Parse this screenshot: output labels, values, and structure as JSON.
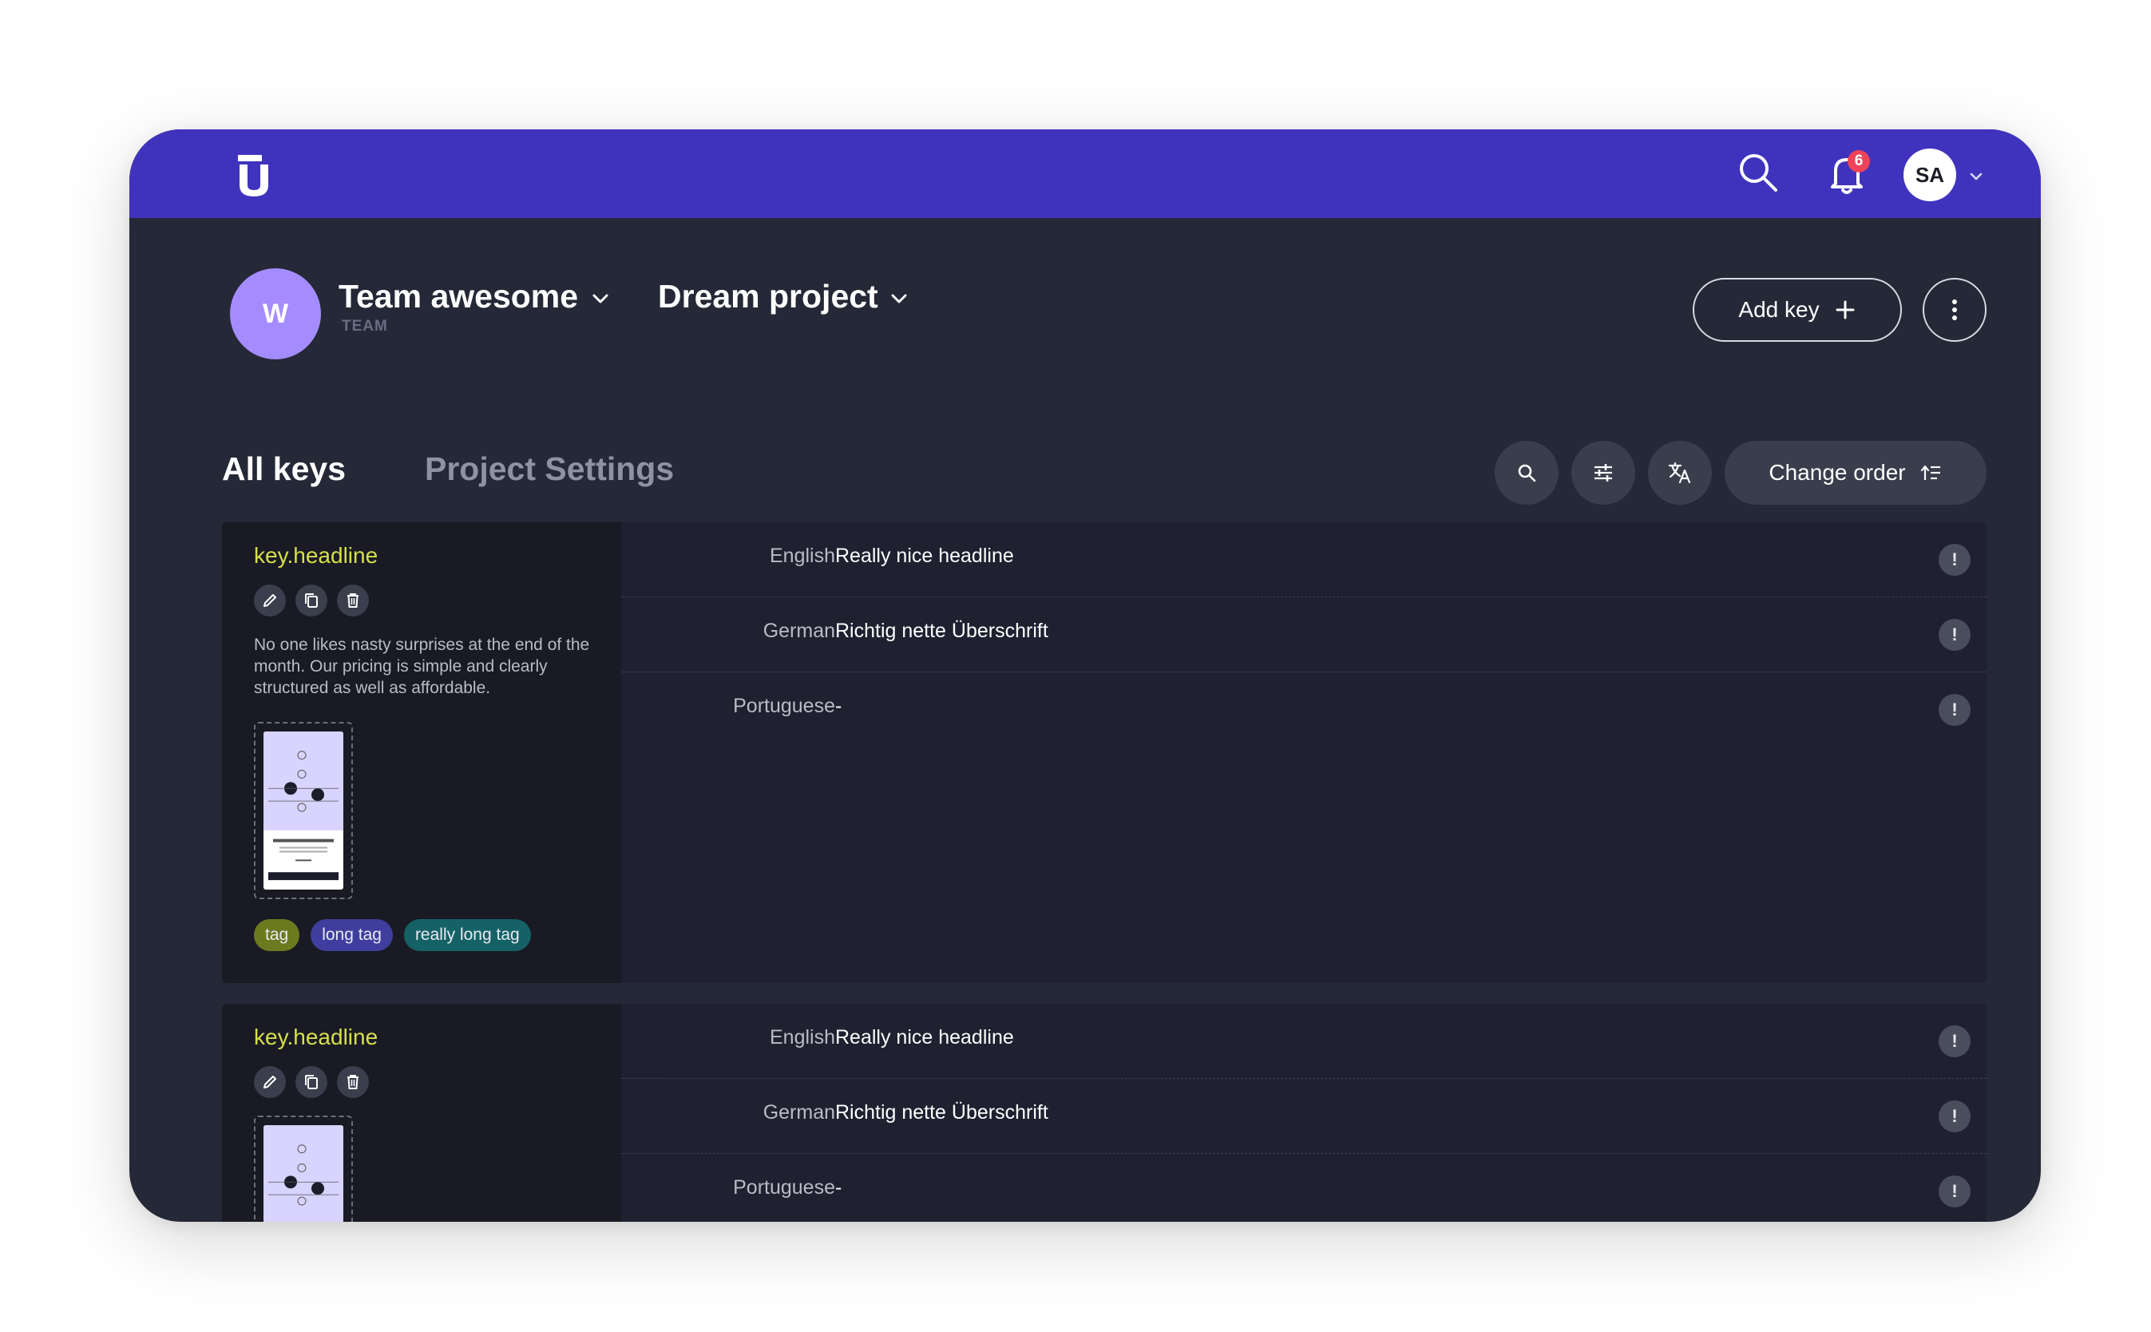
{
  "topbar": {
    "notification_count": "6",
    "user_initials": "SA"
  },
  "header": {
    "team_initial": "W",
    "team_name": "Team awesome",
    "team_label": "TEAM",
    "project_name": "Dream project",
    "add_key_label": "Add key"
  },
  "tabs": {
    "active": "All keys",
    "inactive": "Project Settings"
  },
  "toolbar": {
    "change_order_label": "Change order"
  },
  "keys": [
    {
      "name": "key.headline",
      "description": "No one likes nasty surprises at the end of the month. Our pricing is simple and clearly structured as well as affordable.",
      "tags": [
        "tag",
        "long tag",
        "really long tag"
      ],
      "translations": [
        {
          "language": "English",
          "value": "Really nice headline"
        },
        {
          "language": "German",
          "value": "Richtig nette Überschrift"
        },
        {
          "language": "Portuguese",
          "value": "-"
        }
      ]
    },
    {
      "name": "key.headline",
      "translations": [
        {
          "language": "English",
          "value": "Really nice headline"
        },
        {
          "language": "German",
          "value": "Richtig nette Überschrift"
        },
        {
          "language": "Portuguese",
          "value": "-"
        }
      ]
    }
  ],
  "colors": {
    "topbar": "#3F33BE",
    "background": "#252836",
    "key_name": "#D6E04A",
    "team_avatar": "#A48CFF",
    "notification_badge": "#F0435A"
  }
}
